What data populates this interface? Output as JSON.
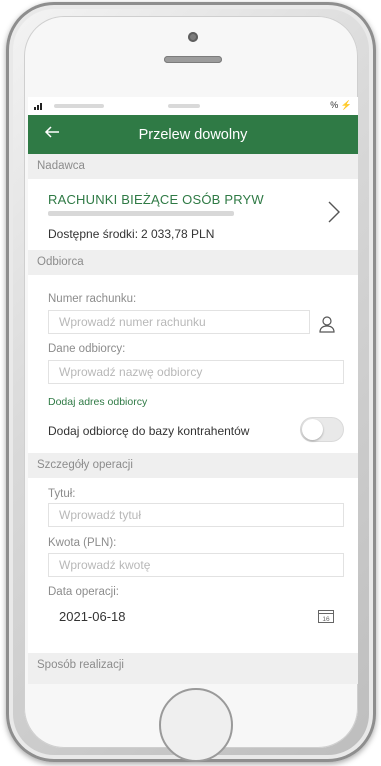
{
  "app": {
    "title": "Przelew dowolny"
  },
  "status": {
    "battery": "%",
    "bolt": "⚡"
  },
  "sender": {
    "section_label": "Nadawca",
    "account_name": "RACHUNKI BIEŻĄCE OSÓB PRYW",
    "balance_label": "Dostępne środki:",
    "balance_value": "2 033,78 PLN"
  },
  "recipient": {
    "section_label": "Odbiorca",
    "account_number_label": "Numer rachunku:",
    "account_number_placeholder": "Wprowadź numer rachunku",
    "recipient_data_label": "Dane odbiorcy:",
    "recipient_data_placeholder": "Wprowadź nazwę odbiorcy",
    "add_address_link": "Dodaj adres odbiorcy",
    "add_to_contractors_label": "Dodaj odbiorcę do bazy kontrahentów",
    "add_to_contractors_enabled": false
  },
  "details": {
    "section_label": "Szczegóły operacji",
    "title_label": "Tytuł:",
    "title_placeholder": "Wprowadź tytuł",
    "amount_label": "Kwota (PLN):",
    "amount_placeholder": "Wprowadź kwotę",
    "date_label": "Data operacji:",
    "date_value": "2021-06-18",
    "calendar_day": "16"
  },
  "method": {
    "section_label": "Sposób realizacji"
  },
  "colors": {
    "brand_green": "#2f7a45",
    "background": "#efefef"
  }
}
